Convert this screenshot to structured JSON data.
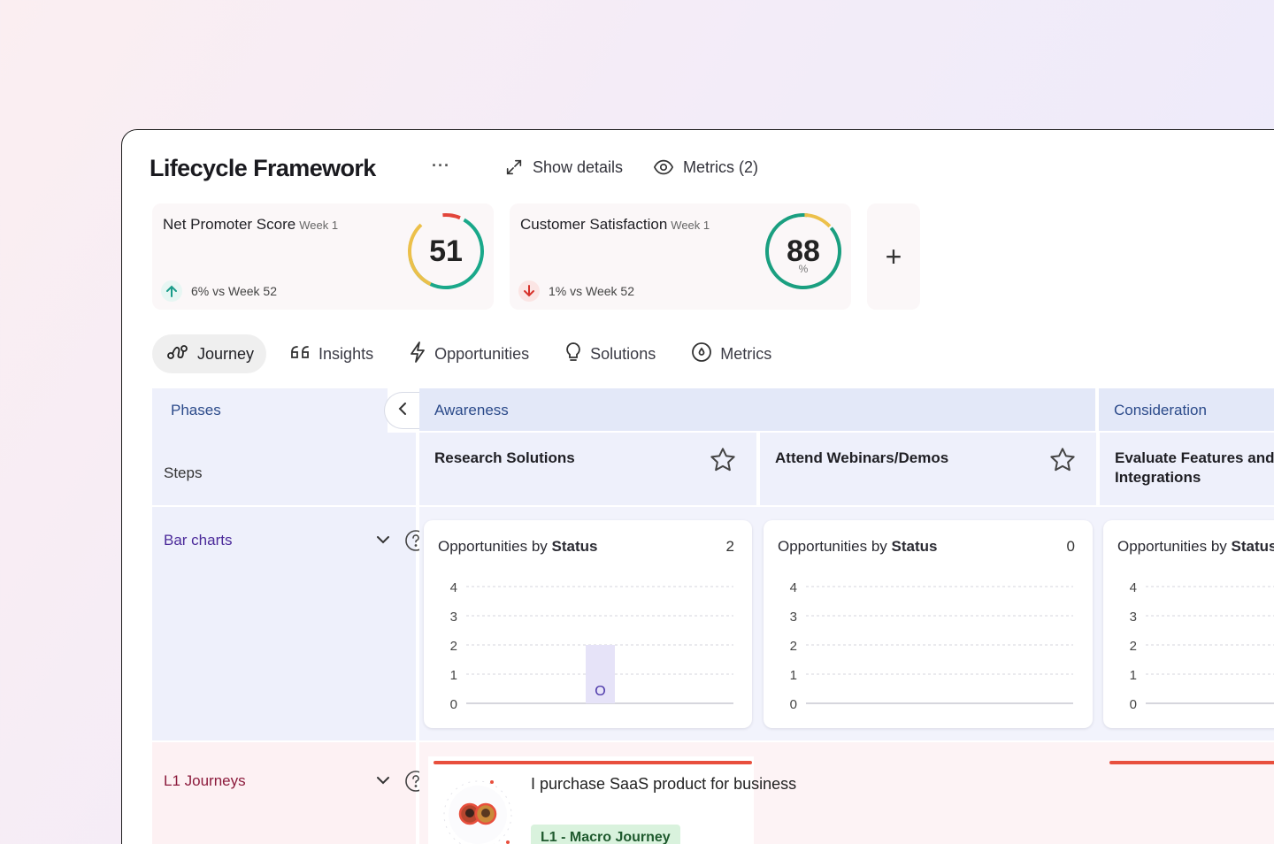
{
  "header": {
    "title": "Lifecycle Framework",
    "more_label": "···",
    "show_details": "Show details",
    "metrics_label": "Metrics (2)"
  },
  "metrics": [
    {
      "label": "Net Promoter Score",
      "week": "Week 1",
      "value": "51",
      "unit": "",
      "trend": "6% vs Week 52",
      "direction": "up",
      "trend_color": "#1a9c8a"
    },
    {
      "label": "Customer Satisfaction",
      "week": "Week 1",
      "value": "88",
      "unit": "%",
      "trend": "1% vs Week 52",
      "direction": "down",
      "trend_color": "#d6322b"
    }
  ],
  "add_metric_label": "+",
  "tabs": [
    {
      "label": "Journey",
      "icon": "journey-icon",
      "active": true
    },
    {
      "label": "Insights",
      "icon": "quote-icon",
      "active": false
    },
    {
      "label": "Opportunities",
      "icon": "lightning-icon",
      "active": false
    },
    {
      "label": "Solutions",
      "icon": "lightbulb-icon",
      "active": false
    },
    {
      "label": "Metrics",
      "icon": "gauge-icon",
      "active": false
    }
  ],
  "grid": {
    "phases_label": "Phases",
    "steps_label": "Steps",
    "phases": [
      "Awareness",
      "Consideration"
    ],
    "steps": [
      "Research Solutions",
      "Attend Webinars/Demos",
      "Evaluate Features and Integrations"
    ],
    "rows": {
      "bar_charts": "Bar charts",
      "l1_journeys": "L1 Journeys"
    }
  },
  "charts": [
    {
      "title_prefix": "Opportunities by",
      "title_bold": "Status",
      "count": "2"
    },
    {
      "title_prefix": "Opportunities by",
      "title_bold": "Status",
      "count": "0"
    },
    {
      "title_prefix": "Opportunities by",
      "title_bold": "Status",
      "count": ""
    }
  ],
  "chart_data": [
    {
      "type": "bar",
      "title": "Opportunities by Status",
      "yticks": [
        4,
        3,
        2,
        1,
        0
      ],
      "ylim": [
        0,
        4
      ],
      "bars": [
        {
          "value": 2,
          "label": "O"
        }
      ]
    },
    {
      "type": "bar",
      "title": "Opportunities by Status",
      "yticks": [
        4,
        3,
        2,
        1,
        0
      ],
      "ylim": [
        0,
        4
      ],
      "bars": []
    },
    {
      "type": "bar",
      "title": "Opportunities by Status",
      "yticks": [
        4,
        3,
        2,
        1,
        0
      ],
      "ylim": [
        0,
        4
      ],
      "bars": []
    }
  ],
  "journey": {
    "title": "I purchase SaaS product for business",
    "badge": "L1 - Macro Journey"
  },
  "colors": {
    "gauge_track_green": "#1aa88a",
    "gauge_yellow": "#ecc04a",
    "gauge_red": "#e2453a",
    "bar_fill": "#e6e3f8",
    "bar_label": "#4a35a8",
    "journey_bar": "#e84f3d"
  }
}
